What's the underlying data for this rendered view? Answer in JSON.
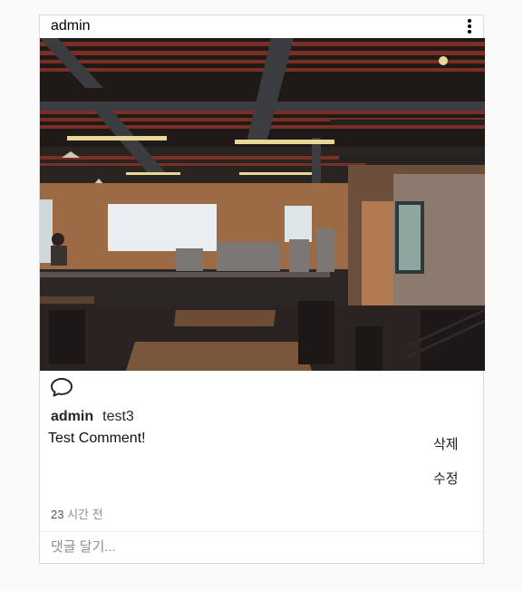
{
  "post": {
    "author": "admin",
    "caption_user": "admin",
    "caption_text": "test3",
    "image_alt": "cafe interior photo",
    "icons": {
      "more": "more-vertical-icon",
      "comment": "comment-icon"
    },
    "comments": [
      {
        "text": "Test Comment!",
        "delete_label": "삭제",
        "edit_label": "수정"
      }
    ],
    "time_number": "23",
    "time_unit": "시간 전",
    "add_comment_placeholder": "댓글 달기..."
  }
}
